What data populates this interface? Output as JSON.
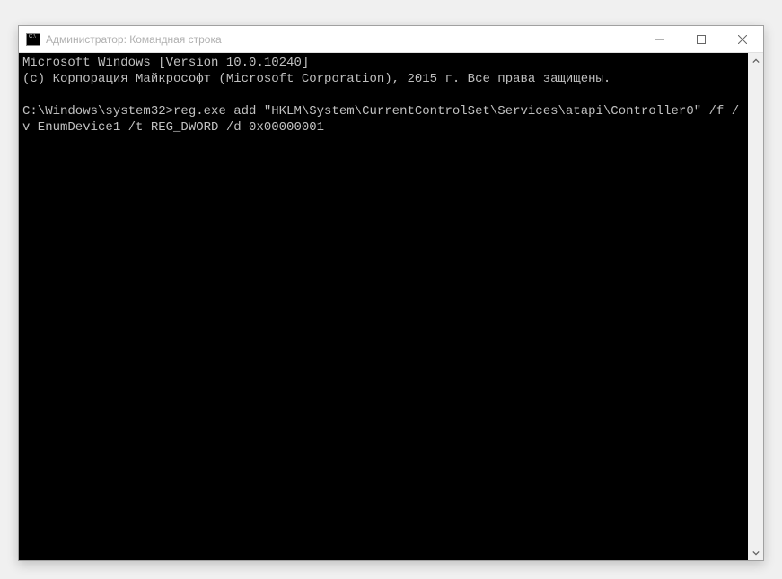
{
  "window": {
    "title": "Администратор: Командная строка"
  },
  "terminal": {
    "header_line1": "Microsoft Windows [Version 10.0.10240]",
    "header_line2": "(c) Корпорация Майкрософт (Microsoft Corporation), 2015 г. Все права защищены.",
    "prompt": "C:\\Windows\\system32>",
    "command": "reg.exe add \"HKLM\\System\\CurrentControlSet\\Services\\atapi\\Controller0\" /f /v EnumDevice1 /t REG_DWORD /d 0x00000001"
  }
}
